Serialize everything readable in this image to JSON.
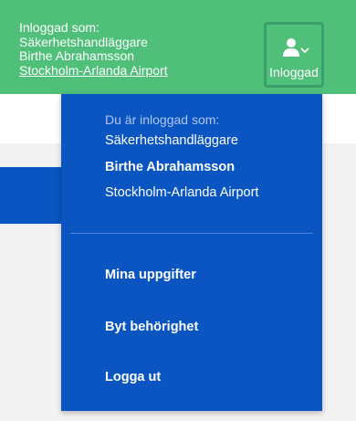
{
  "header": {
    "logged_in_as": "Inloggad som:",
    "role": "Säkerhetshandläggare",
    "name": "Birthe Abrahamsson",
    "location": "Stockholm-Arlanda Airport",
    "user_button_label": "Inloggad",
    "user_icon": "user-icon",
    "caret_icon": "chevron-down-icon"
  },
  "dropdown": {
    "caption": "Du är inloggad som:",
    "role": "Säkerhetshandläggare",
    "name": "Birthe Abrahamsson",
    "location": "Stockholm-Arlanda Airport",
    "items": [
      {
        "label": "Mina uppgifter"
      },
      {
        "label": "Byt behörighet"
      },
      {
        "label": "Logga ut"
      }
    ]
  },
  "colors": {
    "header_green": "#4fbf7a",
    "dropdown_blue": "#0a55c2",
    "background_gray": "#f2f2f2"
  }
}
